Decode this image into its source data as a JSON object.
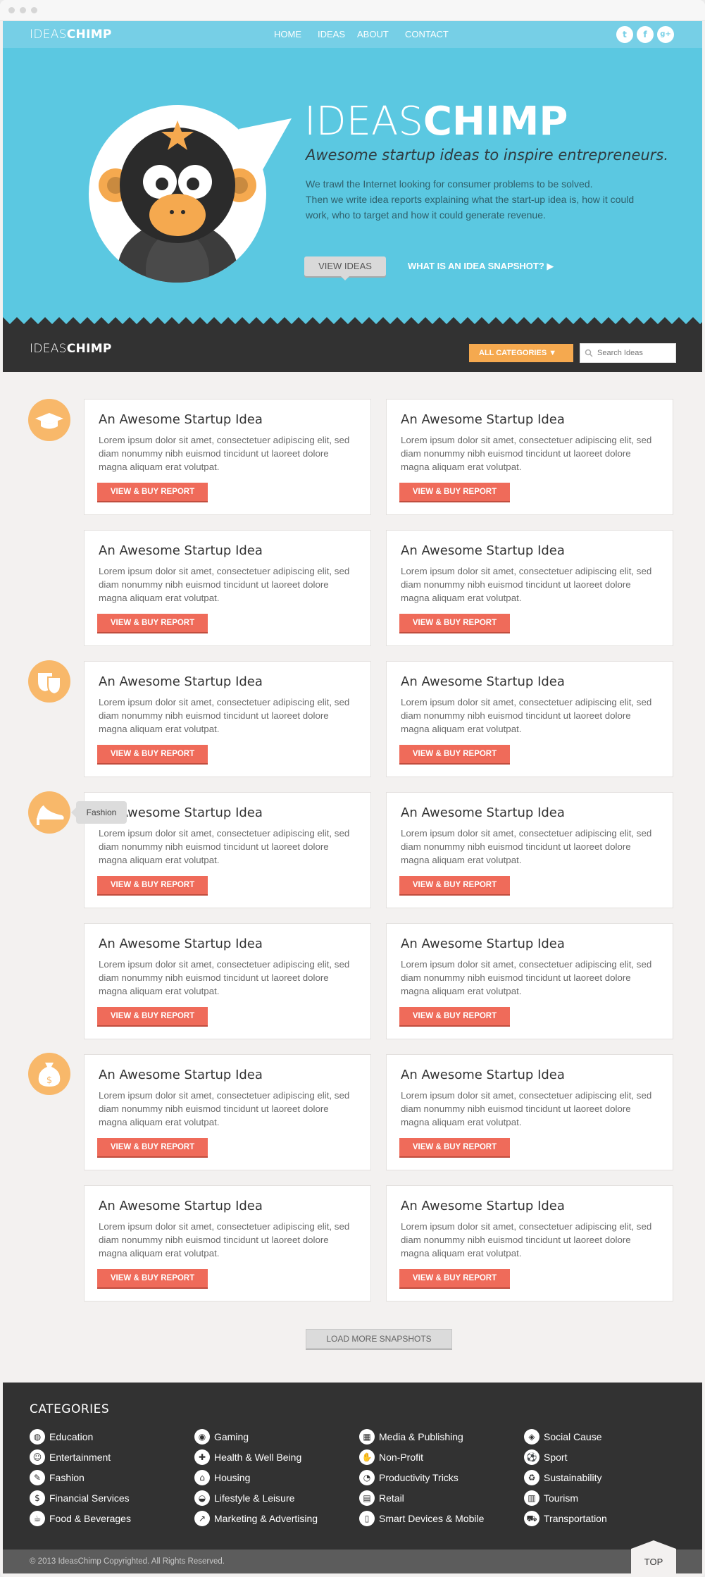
{
  "brand": {
    "logo_light": "IDEAS",
    "logo_bold": "CHIMP"
  },
  "nav": {
    "items": [
      "HOME",
      "IDEAS",
      "ABOUT",
      "CONTACT"
    ]
  },
  "social": {
    "twitter": "t",
    "facebook": "f",
    "gplus": "g+"
  },
  "hero": {
    "title_light": "IDEAS",
    "title_bold": "CHIMP",
    "tagline": "Awesome startup ideas to inspire entrepreneurs.",
    "desc_line1": "We trawl the Internet looking for consumer problems to be solved.",
    "desc_line2": "Then  we write idea reports explaining what the start-up idea is, how it could work, who to target and how it could generate revenue.",
    "view_ideas": "VIEW IDEAS",
    "snapshot_link": "WHAT IS AN IDEA SNAPSHOT? ▶"
  },
  "subbar": {
    "categories_button": "ALL CATEGORIES ▼",
    "search_placeholder": "Search Ideas"
  },
  "card": {
    "title": "An Awesome Startup Idea",
    "text": "Lorem ipsum dolor sit amet, consectetuer adipiscing elit, sed diam nonummy nibh euismod tincidunt ut laoreet dolore magna aliquam erat volutpat.",
    "button": "VIEW & BUY REPORT"
  },
  "category_icons": [
    "graduation-cap-icon",
    "theatre-masks-icon",
    "high-heel-icon",
    "money-bag-icon"
  ],
  "tooltip": "Fashion",
  "load_more": "LOAD MORE SNAPSHOTS",
  "footer": {
    "title": "CATEGORIES",
    "columns": [
      [
        "Education",
        "Entertainment",
        "Fashion",
        "Financial Services",
        "Food & Beverages"
      ],
      [
        "Gaming",
        "Health & Well Being",
        "Housing",
        "Lifestyle & Leisure",
        "Marketing & Advertising"
      ],
      [
        "Media & Publishing",
        "Non-Profit",
        "Productivity Tricks",
        "Retail",
        "Smart Devices & Mobile"
      ],
      [
        "Social Cause",
        "Sport",
        "Sustainability",
        "Tourism",
        "Transportation"
      ]
    ],
    "copyright": "© 2013 IdeasChimp Copyrighted. All Rights Reserved.",
    "top": "TOP"
  },
  "colors": {
    "hero": "#5bc8e1",
    "nav": "#76cfe6",
    "dark": "#323232",
    "accent_orange": "#f5a94f",
    "button_red": "#ef6b5a"
  }
}
